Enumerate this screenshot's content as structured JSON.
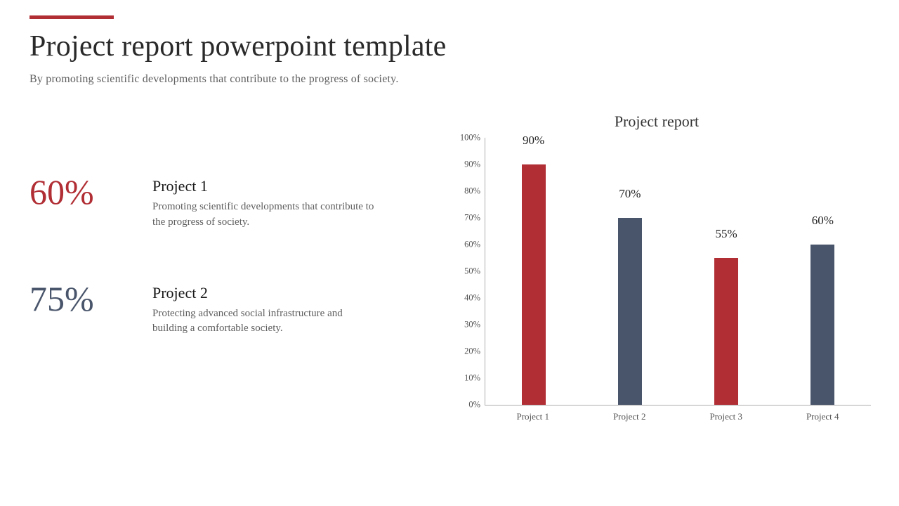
{
  "header": {
    "title": "Project report powerpoint template",
    "subtitle": "By promoting scientific developments that contribute to the progress of society."
  },
  "stats": [
    {
      "pct": "60%",
      "color": "red",
      "title": "Project 1",
      "desc": "Promoting scientific developments that contribute to the progress of society."
    },
    {
      "pct": "75%",
      "color": "slate",
      "title": "Project 2",
      "desc": "Protecting advanced social infrastructure and building a comfortable society."
    }
  ],
  "chart_data": {
    "type": "bar",
    "title": "Project report",
    "categories": [
      "Project 1",
      "Project 2",
      "Project 3",
      "Project 4"
    ],
    "values": [
      90,
      70,
      55,
      60
    ],
    "value_labels": [
      "90%",
      "70%",
      "55%",
      "60%"
    ],
    "colors": [
      "red",
      "slate",
      "red",
      "slate"
    ],
    "xlabel": "",
    "ylabel": "",
    "ylim": [
      0,
      100
    ],
    "y_ticks": [
      0,
      10,
      20,
      30,
      40,
      50,
      60,
      70,
      80,
      90,
      100
    ],
    "y_tick_labels": [
      "0%",
      "10%",
      "20%",
      "30%",
      "40%",
      "50%",
      "60%",
      "70%",
      "80%",
      "90%",
      "100%"
    ]
  },
  "colors": {
    "accent_red": "#B02E34",
    "slate": "#49556B"
  }
}
